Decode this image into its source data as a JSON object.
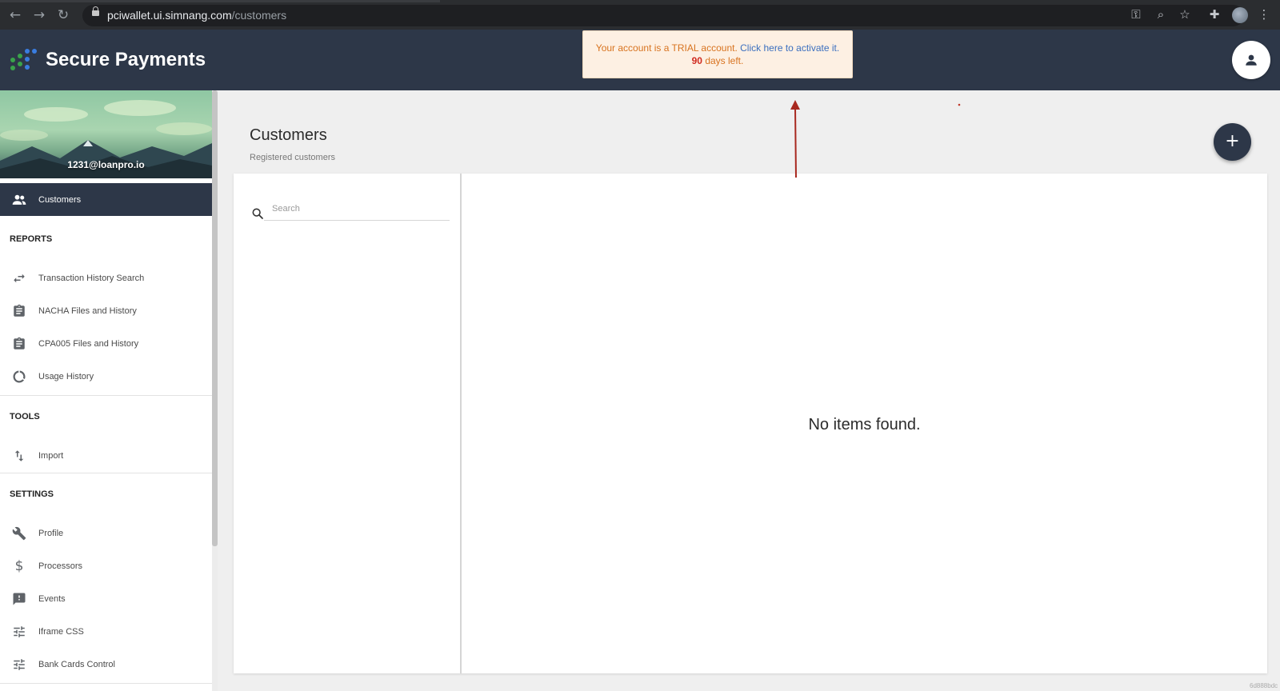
{
  "browser": {
    "url_host": "pciwallet.ui.simnang.com",
    "url_path": "/customers"
  },
  "header": {
    "app_title": "Secure Payments",
    "trial": {
      "line1_prefix": "Your account is a TRIAL account.",
      "link_text": "Click here to activate it.",
      "days": "90",
      "days_suffix": "days left."
    }
  },
  "sidebar": {
    "user_email": "1231@loanpro.io",
    "active_item": "Customers",
    "sections": {
      "reports": "REPORTS",
      "tools": "TOOLS",
      "settings": "SETTINGS"
    },
    "reports_items": [
      {
        "label": "Transaction History Search",
        "icon": "swap-arrows-icon"
      },
      {
        "label": "NACHA Files and History",
        "icon": "clipboard-icon"
      },
      {
        "label": "CPA005 Files and History",
        "icon": "clipboard-icon"
      },
      {
        "label": "Usage History",
        "icon": "ring-icon"
      }
    ],
    "tools_items": [
      {
        "label": "Import",
        "icon": "import-arrows-icon"
      }
    ],
    "settings_items": [
      {
        "label": "Profile",
        "icon": "wrench-icon"
      },
      {
        "label": "Processors",
        "icon": "dollar-icon"
      },
      {
        "label": "Events",
        "icon": "feedback-icon"
      },
      {
        "label": "Iframe CSS",
        "icon": "tune-icon"
      },
      {
        "label": "Bank Cards Control",
        "icon": "tune-icon"
      }
    ]
  },
  "main": {
    "title": "Customers",
    "subtitle": "Registered customers",
    "search_placeholder": "Search",
    "empty_message": "No items found.",
    "add_button_symbol": "+"
  },
  "footer": {
    "corner_text": "6d888bdc"
  },
  "colors": {
    "header_bg": "#2d3748",
    "trial_text": "#d8731f",
    "trial_link": "#3b6fbf",
    "trial_days": "#d02a1f"
  }
}
